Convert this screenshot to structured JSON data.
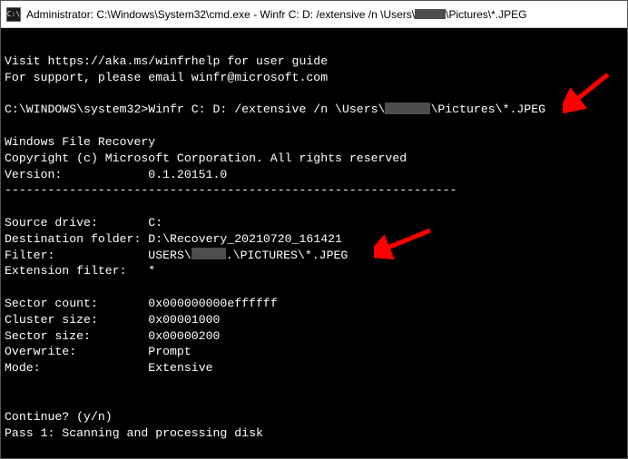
{
  "titlebar": {
    "text_before": "Administrator: C:\\Windows\\System32\\cmd.exe - Winfr  C: D: /extensive /n \\Users\\",
    "text_after": "\\Pictures\\*.JPEG"
  },
  "lines": {
    "help1": "Visit https://aka.ms/winfrhelp for user guide",
    "help2": "For support, please email winfr@microsoft.com",
    "prompt_pre": "C:\\WINDOWS\\system32>Winfr C: D: /extensive /n \\Users\\",
    "prompt_post": "\\Pictures\\*.JPEG",
    "app_name": "Windows File Recovery",
    "copyright": "Copyright (c) Microsoft Corporation. All rights reserved",
    "version_label": "Version:",
    "version_value": "0.1.20151.0",
    "divider": "---------------------------------------------------------------",
    "src_label": "Source drive:",
    "src_value": "C:",
    "dest_label": "Destination folder:",
    "dest_value": "D:\\Recovery_20210720_161421",
    "filter_label": "Filter:",
    "filter_pre": "USERS\\",
    "filter_post": ".\\PICTURES\\*.JPEG",
    "ext_label": "Extension filter:",
    "ext_value": "*",
    "sector_count_label": "Sector count:",
    "sector_count_value": "0x000000000effffff",
    "cluster_label": "Cluster size:",
    "cluster_value": "0x00001000",
    "sector_size_label": "Sector size:",
    "sector_size_value": "0x00000200",
    "overwrite_label": "Overwrite:",
    "overwrite_value": "Prompt",
    "mode_label": "Mode:",
    "mode_value": "Extensive",
    "continue": "Continue? (y/n)",
    "pass1": "Pass 1: Scanning and processing disk"
  }
}
